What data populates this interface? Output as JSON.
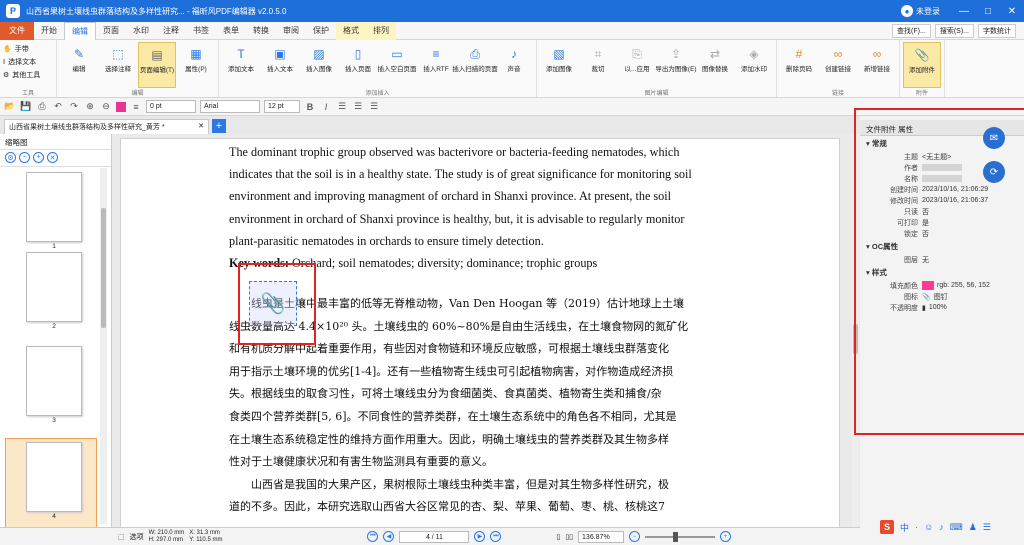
{
  "titlebar": {
    "title": "山西省果树土壤线虫群落结构及多样性研究... - 福昕风PDF编辑器 v2.0.5.0",
    "login": "未登录",
    "minimize": "—",
    "maximize": "□",
    "close": "✕"
  },
  "menu": {
    "file": "文件",
    "tabs": [
      "开始",
      "编辑",
      "页面",
      "水印",
      "注释",
      "书签",
      "表单",
      "转换",
      "审阅",
      "保护",
      "格式",
      "排列"
    ],
    "right": [
      "查找(F)...",
      "搜索(S)...",
      "字数统计"
    ]
  },
  "ribbon": {
    "tools": [
      "手带",
      "选择文本",
      "其他工具"
    ],
    "tools_label": "工具",
    "edit_group": [
      "编辑",
      "选择注释",
      "页面编辑(T)",
      "属性(P)"
    ],
    "edit_label": "编辑",
    "insert_group": [
      "添加文本",
      "插入文本",
      "插入图像",
      "插入页面",
      "插入空白页面",
      "插入RTF",
      "插入扫描的页面",
      "声音"
    ],
    "insert_label": "添加插入",
    "image_group": [
      "添加图像",
      "裁切",
      "以...应用",
      "导出为图像(E)",
      "图像替换",
      "添加水印"
    ],
    "image_label": "图片编辑",
    "link_group": [
      "删除页码",
      "创建链接",
      "新增链接"
    ],
    "link_label": "链接",
    "attach_group": [
      "添加附件"
    ],
    "attach_label": "附件"
  },
  "format": {
    "size": "0 pt",
    "font": "Arial",
    "font_size": "12 pt"
  },
  "doctab": {
    "label": "山西省果树土壤线虫群落结构及多样性研究_黄芳 *",
    "close": "✕",
    "add": "+"
  },
  "thumbs": {
    "title": "缩略图",
    "pages": [
      "1",
      "2",
      "3",
      "4"
    ]
  },
  "document": {
    "english": [
      "The dominant trophic group observed was bacterivore or bacteria-feeding nematodes, which",
      "indicates that the soil is in a healthy state. The study is of great significance for monitoring soil",
      "environment and improving managment of orchard in Shanxi province. At present, the soil",
      "environment in orchard of Shanxi province is healthy, but, it is advisable to regularly monitor",
      "plant-parasitic nematodes in orchards to ensure timely detection."
    ],
    "keywords_label": "Key words:",
    "keywords": " Orchard; soil nematodes; diversity; dominance; trophic groups",
    "chinese": [
      "线虫是土壤中最丰富的低等无脊椎动物，Van Den Hoogan 等（2019）估计地球上土壤",
      "线虫数量高达 4.4×10²⁰ 头。土壤线虫的 60%~80%是自由生活线虫，在土壤食物网的氮矿化",
      "和有机质分解中起着重要作用，有些因对食物链和环境反应敏感，可根据土壤线虫群落变化",
      "用于指示土壤环境的优劣[1-4]。还有一些植物寄生线虫可引起植物病害，对作物造成经济损",
      "失。根据线虫的取食习性，可将土壤线虫分为食细菌类、食真菌类、植物寄生类和捕食/杂",
      "食类四个营养类群[5, 6]。不同食性的营养类群，在土壤生态系统中的角色各不相同，尤其是",
      "在土壤生态系统稳定性的维持方面作用重大。因此，明确土壤线虫的营养类群及其生物多样",
      "性对于土壤健康状况和有害生物监测具有重要的意义。",
      "山西省是我国的大果产区，果树根际土壤线虫种类丰富，但是对其生物多样性研究，极",
      "道的不多。因此，本研究选取山西省大谷区常见的杏、梨、苹果、葡萄、枣、桃、核桃这7"
    ]
  },
  "statusbar": {
    "mode": "选项",
    "width": "W: 210.0 mm",
    "height": "H: 297.0 mm",
    "x": "X: 31.3 mm",
    "y": "Y: 110.5 mm",
    "page": "4 / 11",
    "zoom": "136.87%"
  },
  "props": {
    "title": "文件附件 属性",
    "general_label": "常规",
    "general": [
      {
        "k": "主题",
        "v": "<无主题>"
      },
      {
        "k": "作者",
        "v": ""
      },
      {
        "k": "名称",
        "v": ""
      },
      {
        "k": "创建时间",
        "v": "2023/10/16, 21:06:29"
      },
      {
        "k": "修改时间",
        "v": "2023/10/16, 21:06:37"
      },
      {
        "k": "只读",
        "v": "否"
      },
      {
        "k": "可打印",
        "v": "是"
      },
      {
        "k": "锁定",
        "v": "否"
      }
    ],
    "oc_label": "OC属性",
    "oc": [
      {
        "k": "图层",
        "v": "无"
      }
    ],
    "style_label": "样式",
    "style": [
      {
        "k": "填充颜色",
        "v": "rgb: 255, 56, 152"
      },
      {
        "k": "图标",
        "v": "图钉"
      },
      {
        "k": "不透明度",
        "v": "100%"
      }
    ],
    "fill_color": "#ff3898"
  },
  "tray": {
    "ime": "S",
    "icons": [
      "中",
      "·",
      "☺",
      "♪",
      "⌨",
      "♟",
      "☰"
    ]
  },
  "colors": {
    "titlebar": "#1e6fd9",
    "file_tab": "#e05a2b",
    "highlight_frame": "#e32222",
    "annot_fill": "#e8358f"
  }
}
